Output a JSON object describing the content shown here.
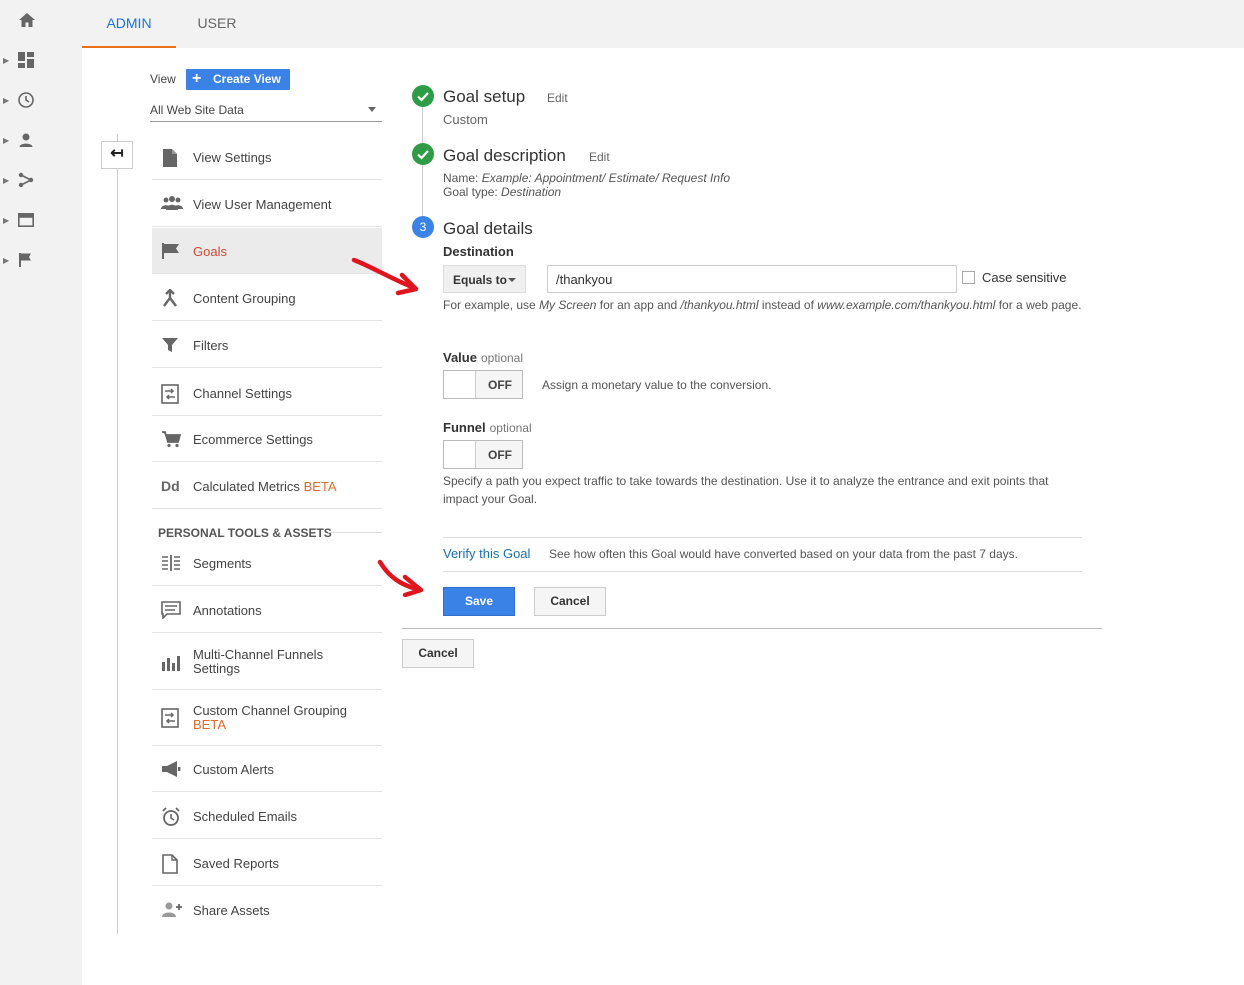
{
  "tabs": {
    "admin": "ADMIN",
    "user": "USER"
  },
  "view": {
    "label": "View",
    "create_button": "Create View",
    "selected": "All Web Site Data"
  },
  "nav": {
    "items": [
      {
        "label": "View Settings"
      },
      {
        "label": "View User Management"
      },
      {
        "label": "Goals"
      },
      {
        "label": "Content Grouping"
      },
      {
        "label": "Filters"
      },
      {
        "label": "Channel Settings"
      },
      {
        "label": "Ecommerce Settings"
      },
      {
        "label": "Calculated Metrics",
        "badge": "BETA"
      }
    ],
    "section_title": "PERSONAL TOOLS & ASSETS",
    "personal": [
      {
        "label": "Segments"
      },
      {
        "label": "Annotations"
      },
      {
        "label": "Multi-Channel Funnels",
        "label2": "Settings"
      },
      {
        "label": "Custom Channel Grouping",
        "badge": "BETA"
      },
      {
        "label": "Custom Alerts"
      },
      {
        "label": "Scheduled Emails"
      },
      {
        "label": "Saved Reports"
      },
      {
        "label": "Share Assets"
      }
    ]
  },
  "goal": {
    "step1": {
      "title": "Goal setup",
      "edit": "Edit",
      "value": "Custom"
    },
    "step2": {
      "title": "Goal description",
      "edit": "Edit",
      "name_label": "Name:",
      "name_value": "Example: Appointment/ Estimate/ Request Info",
      "type_label": "Goal type:",
      "type_value": "Destination"
    },
    "step3": {
      "number": "3",
      "title": "Goal details"
    },
    "destination": {
      "label": "Destination",
      "match_type": "Equals to",
      "value": "/thankyou",
      "case_sensitive": "Case sensitive",
      "hint_1": "For example, use",
      "hint_2": "My Screen",
      "hint_3": "for an app and",
      "hint_4": "/thankyou.html",
      "hint_5": "instead of",
      "hint_6": "www.example.com/thankyou.html",
      "hint_7": "for a web",
      "hint_8": "page."
    },
    "value_section": {
      "label": "Value",
      "optional": "optional",
      "toggle": "OFF",
      "desc": "Assign a monetary value to the conversion."
    },
    "funnel_section": {
      "label": "Funnel",
      "optional": "optional",
      "toggle": "OFF",
      "desc_1": "Specify a path you expect traffic to take towards the destination. Use it to analyze the entrance and exit points that",
      "desc_2": "impact your Goal."
    },
    "verify_link": "Verify this Goal",
    "verify_desc": "See how often this Goal would have converted based on your data from the past 7 days.",
    "save": "Save",
    "cancel": "Cancel",
    "outer_cancel": "Cancel"
  },
  "colors": {
    "accent": "#3b82e6",
    "success": "#2e9c46",
    "active_nav": "#d14836",
    "beta": "#e06c2b",
    "tab_underline": "#e8711a",
    "annotation_arrow": "#e0141c"
  }
}
